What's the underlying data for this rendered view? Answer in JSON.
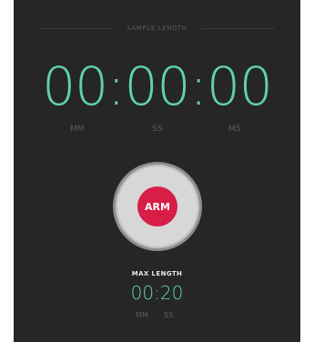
{
  "sample": {
    "title": "SAMPLE LENGTH",
    "time": "00:00:00",
    "units": [
      "MM",
      "SS",
      "MS"
    ]
  },
  "arm_button": {
    "label": "ARM"
  },
  "max": {
    "title": "MAX LENGTH",
    "time": "00:20",
    "units": [
      "MM",
      "SS"
    ]
  },
  "colors": {
    "background": "#262626",
    "time_accent": "#5fd3a7",
    "arm_red": "#d81d47",
    "arm_ring": "#d7d7d7"
  }
}
